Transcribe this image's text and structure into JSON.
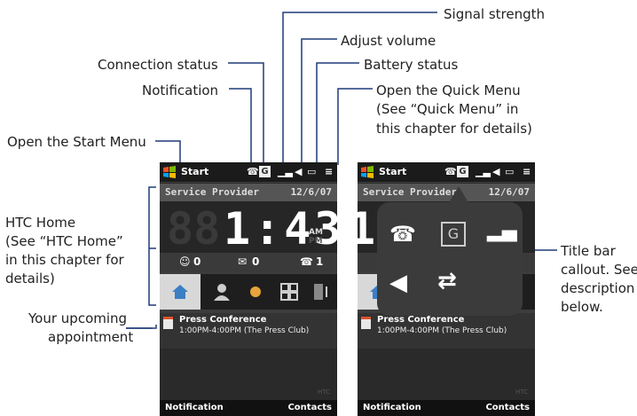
{
  "callouts": {
    "signal_strength": "Signal strength",
    "adjust_volume": "Adjust volume",
    "connection_status": "Connection status",
    "battery_status": "Battery status",
    "notification": "Notification",
    "quick_menu_line1": "Open the Quick Menu",
    "quick_menu_line2": "(See “Quick Menu” in",
    "quick_menu_line3": "this chapter for details)",
    "start_menu": "Open the Start Menu",
    "htc_home_1": "HTC Home",
    "htc_home_2": "(See “HTC Home”",
    "htc_home_3": "in this chapter for",
    "htc_home_4": "details)",
    "appointment_1": "Your upcoming",
    "appointment_2": "appointment",
    "title_bar_1": "Title bar",
    "title_bar_2": "callout. See",
    "title_bar_3": "description",
    "title_bar_4": "below."
  },
  "phone": {
    "start_label": "Start",
    "network_letter": "G",
    "service_provider": "Service Provider",
    "date": "12/6/07",
    "time": "1:43",
    "ghost_digits": "88",
    "ampm_am": "AM",
    "ampm_pm": "PM",
    "count_missed": "0",
    "count_messages": "0",
    "count_calls": "1",
    "appt_title": "Press Conference",
    "appt_detail": "1:00PM-4:00PM (The Press Club)",
    "softkey_left": "Notification",
    "softkey_right": "Contacts",
    "brand": "HTC"
  },
  "colors": {
    "phone_bg": "#2a2a2a",
    "bubble": "#3b3b3b",
    "leader_line": "#1f3b7a"
  },
  "icons": [
    "windows-flag-icon",
    "notification-icon",
    "network-g-icon",
    "signal-icon",
    "volume-icon",
    "battery-icon",
    "quick-menu-icon",
    "home-tab-icon",
    "people-tab-icon",
    "weather-tab-icon",
    "apps-tab-icon",
    "music-tab-icon",
    "calendar-icon",
    "connection-icon"
  ]
}
